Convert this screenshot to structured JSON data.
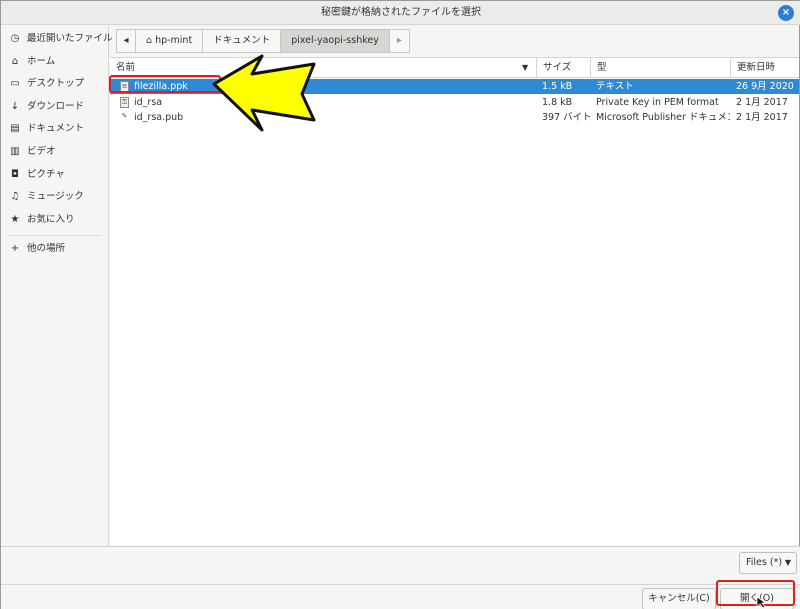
{
  "window": {
    "title": "秘密鍵が格納されたファイルを選択",
    "close_icon": "close-icon"
  },
  "sidebar": {
    "items": [
      {
        "icon": "clock-icon",
        "glyph": "◷",
        "label": "最近開いたファイル"
      },
      {
        "icon": "home-icon",
        "glyph": "⌂",
        "label": "ホーム"
      },
      {
        "icon": "desktop-icon",
        "glyph": "▭",
        "label": "デスクトップ"
      },
      {
        "icon": "download-icon",
        "glyph": "↓",
        "label": "ダウンロード"
      },
      {
        "icon": "document-icon",
        "glyph": "▤",
        "label": "ドキュメント"
      },
      {
        "icon": "video-icon",
        "glyph": "▥",
        "label": "ビデオ"
      },
      {
        "icon": "camera-icon",
        "glyph": "◘",
        "label": "ピクチャ"
      },
      {
        "icon": "music-icon",
        "glyph": "♫",
        "label": "ミュージック"
      },
      {
        "icon": "star-icon",
        "glyph": "★",
        "label": "お気に入り"
      },
      {
        "icon": "plus-icon",
        "glyph": "+",
        "label": "他の場所"
      }
    ]
  },
  "pathbar": {
    "back_glyph": "◂",
    "forward_glyph": "▸",
    "home_glyph": "⌂",
    "crumbs": [
      "hp-mint",
      "ドキュメント",
      "pixel-yaopi-sshkey"
    ]
  },
  "files": {
    "columns": {
      "name": "名前",
      "size": "サイズ",
      "type": "型",
      "modified": "更新日時"
    },
    "sort_glyph": "▼",
    "rows": [
      {
        "name": "filezilla.ppk",
        "size": "1.5 kB",
        "type": "テキスト",
        "modified": "26 9月 2020",
        "icon_glyph": "≡"
      },
      {
        "name": "id_rsa",
        "size": "1.8 kB",
        "type": "Private Key in PEM format",
        "modified": "2 1月 2017",
        "icon_glyph": "⚿"
      },
      {
        "name": "id_rsa.pub",
        "size": "397 バイト",
        "type": "Microsoft Publisher ドキュメント",
        "modified": "2 1月 2017",
        "icon_glyph": "✎"
      }
    ]
  },
  "footer": {
    "filter_label": "Files (*)",
    "filter_caret": "▼",
    "cancel_label": "キャンセル(C)",
    "open_label": "開く(O)"
  },
  "colors": {
    "selection": "#2f8ad6",
    "annotation_red": "#e31d1d",
    "annotation_arrow": "#ffff00"
  }
}
